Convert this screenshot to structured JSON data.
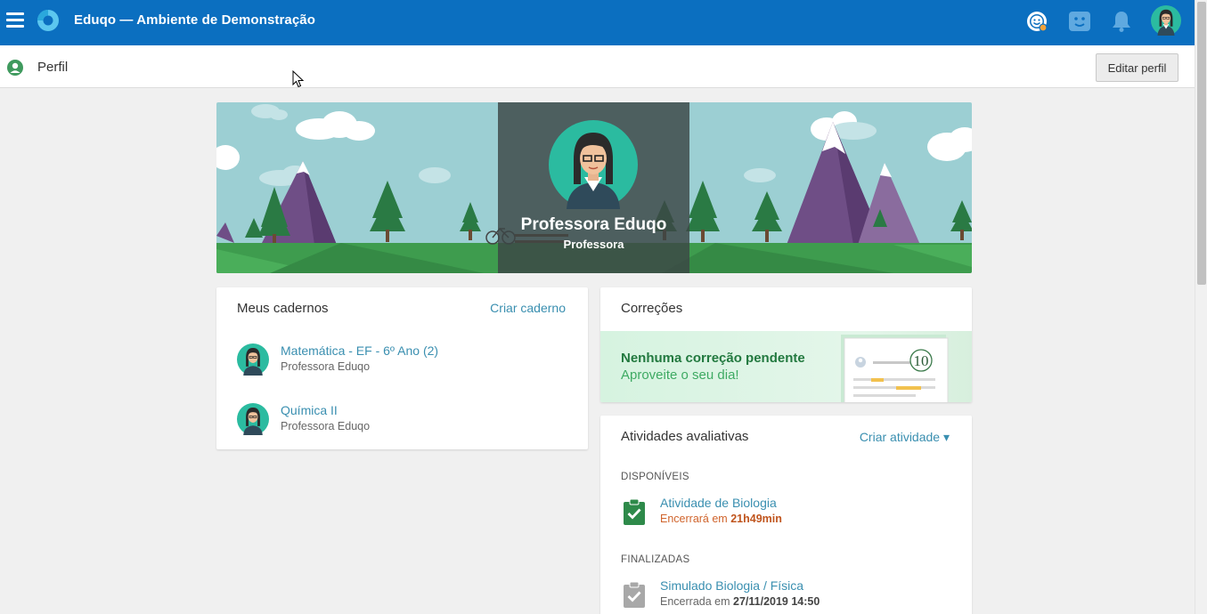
{
  "app": {
    "title": "Eduqo — Ambiente de Demonstração",
    "brand_color": "#0b6fc0"
  },
  "topbar": {
    "icons": [
      "menu-icon",
      "eduqo-logo",
      "support-icon",
      "extensions-icon",
      "notifications-icon",
      "user-avatar"
    ]
  },
  "subheader": {
    "title": "Perfil",
    "edit_button": "Editar perfil"
  },
  "profile": {
    "name": "Professora Eduqo",
    "role": "Professora"
  },
  "notebooks": {
    "title": "Meus cadernos",
    "create_link": "Criar caderno",
    "items": [
      {
        "name": "Matemática - EF - 6º Ano (2)",
        "owner": "Professora Eduqo"
      },
      {
        "name": "Química II",
        "owner": "Professora Eduqo"
      }
    ]
  },
  "corrections": {
    "title": "Correções",
    "empty_title": "Nenhuma correção pendente",
    "empty_subtitle": "Aproveite o seu dia!",
    "grade_badge": "10"
  },
  "activities": {
    "title": "Atividades avaliativas",
    "create_link": "Criar atividade ▾",
    "available_label": "DISPONÍVEIS",
    "available": [
      {
        "name": "Atividade de Biologia",
        "status_prefix": "Encerrará em",
        "status_value": "21h49min"
      }
    ],
    "finished_label": "FINALIZADAS",
    "finished": [
      {
        "name": "Simulado Biologia / Física",
        "status_prefix": "Encerrada em",
        "status_value": "27/11/2019 14:50"
      }
    ]
  }
}
